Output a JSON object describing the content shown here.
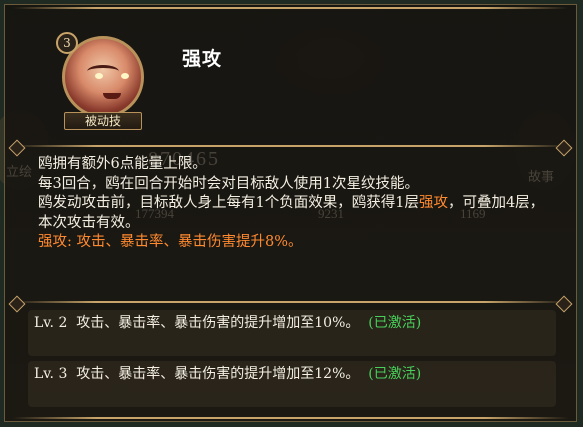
{
  "skill": {
    "level": "3",
    "type_label": "被动技",
    "name": "强攻"
  },
  "background": {
    "power_value": "870465",
    "stats": [
      "177394",
      "9231",
      "1169"
    ],
    "left_label": "立绘",
    "right_label": "故事"
  },
  "description": {
    "line1": "鸥拥有额外6点能量上限。",
    "line2": "每3回合，鸥在回合开始时会对目标敌人使用1次星纹技能。",
    "line3_pre": "鸥发动攻击前，目标敌人身上每有1个负面效果，鸥获得1层",
    "line3_hl": "强攻",
    "line3_post": "，可叠加4层，本次攻击有效。",
    "line4": "强攻: 攻击、暴击率、暴击伤害提升8%。"
  },
  "levels": [
    {
      "label": "Lv. 2",
      "text": "攻击、暴击率、暴击伤害的提升增加至10%。",
      "status": "(已激活)"
    },
    {
      "label": "Lv. 3",
      "text": "攻击、暴击率、暴击伤害的提升增加至12%。",
      "status": "(已激活)"
    }
  ],
  "colors": {
    "highlight": "#ff8a30",
    "activated": "#49d05a",
    "frame_gold": "#c8a46a"
  }
}
